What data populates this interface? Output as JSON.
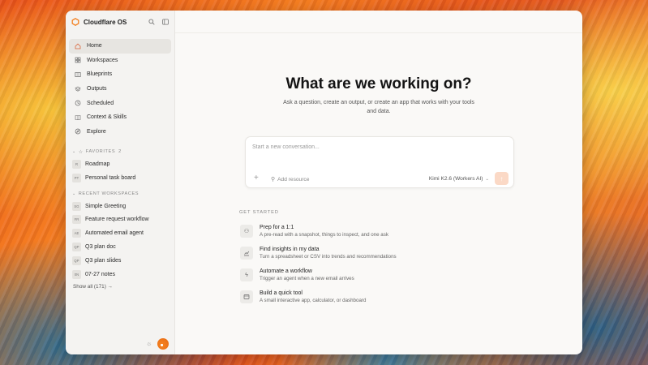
{
  "app": {
    "title": "Cloudflare OS",
    "brand_color": "#f38020"
  },
  "header_icons": [
    "search-icon",
    "sidebar-toggle-icon"
  ],
  "nav": [
    {
      "label": "Home",
      "icon": "home-icon",
      "active": true
    },
    {
      "label": "Workspaces",
      "icon": "grid-icon"
    },
    {
      "label": "Blueprints",
      "icon": "blueprint-icon"
    },
    {
      "label": "Outputs",
      "icon": "layers-icon"
    },
    {
      "label": "Scheduled",
      "icon": "clock-icon"
    },
    {
      "label": "Context & Skills",
      "icon": "book-icon"
    },
    {
      "label": "Explore",
      "icon": "compass-icon"
    }
  ],
  "favorites": {
    "label": "FAVORITES",
    "count": "2",
    "items": [
      {
        "badge": "R",
        "label": "Roadmap"
      },
      {
        "badge": "PT",
        "label": "Personal task board"
      }
    ]
  },
  "recent": {
    "label": "RECENT WORKSPACES",
    "items": [
      {
        "badge": "SG",
        "label": "Simple Greeting"
      },
      {
        "badge": "FR",
        "label": "Feature request workflow"
      },
      {
        "badge": "AE",
        "label": "Automated email agent"
      },
      {
        "badge": "QP",
        "label": "Q3 plan doc"
      },
      {
        "badge": "QP",
        "label": "Q3 plan slides"
      },
      {
        "badge": "0N",
        "label": "07-27 notes"
      }
    ],
    "show_all": "Show all (171) →"
  },
  "hero": {
    "title": "What are we working on?",
    "subtitle": "Ask a question, create an output, or create an app that works with your tools and data."
  },
  "composer": {
    "placeholder": "Start a new conversation...",
    "add_resource": "Add resource",
    "model": "Kimi K2.6 (Workers AI)"
  },
  "get_started": {
    "label": "GET STARTED",
    "items": [
      {
        "title": "Prep for a 1:1",
        "desc": "A pre-read with a snapshot, things to inspect, and one ask",
        "icon": "people-icon"
      },
      {
        "title": "Find insights in my data",
        "desc": "Turn a spreadsheet or CSV into trends and recommendations",
        "icon": "chart-icon"
      },
      {
        "title": "Automate a workflow",
        "desc": "Trigger an agent when a new email arrives",
        "icon": "bolt-icon"
      },
      {
        "title": "Build a quick tool",
        "desc": "A small interactive app, calculator, or dashboard",
        "icon": "window-icon"
      }
    ]
  }
}
